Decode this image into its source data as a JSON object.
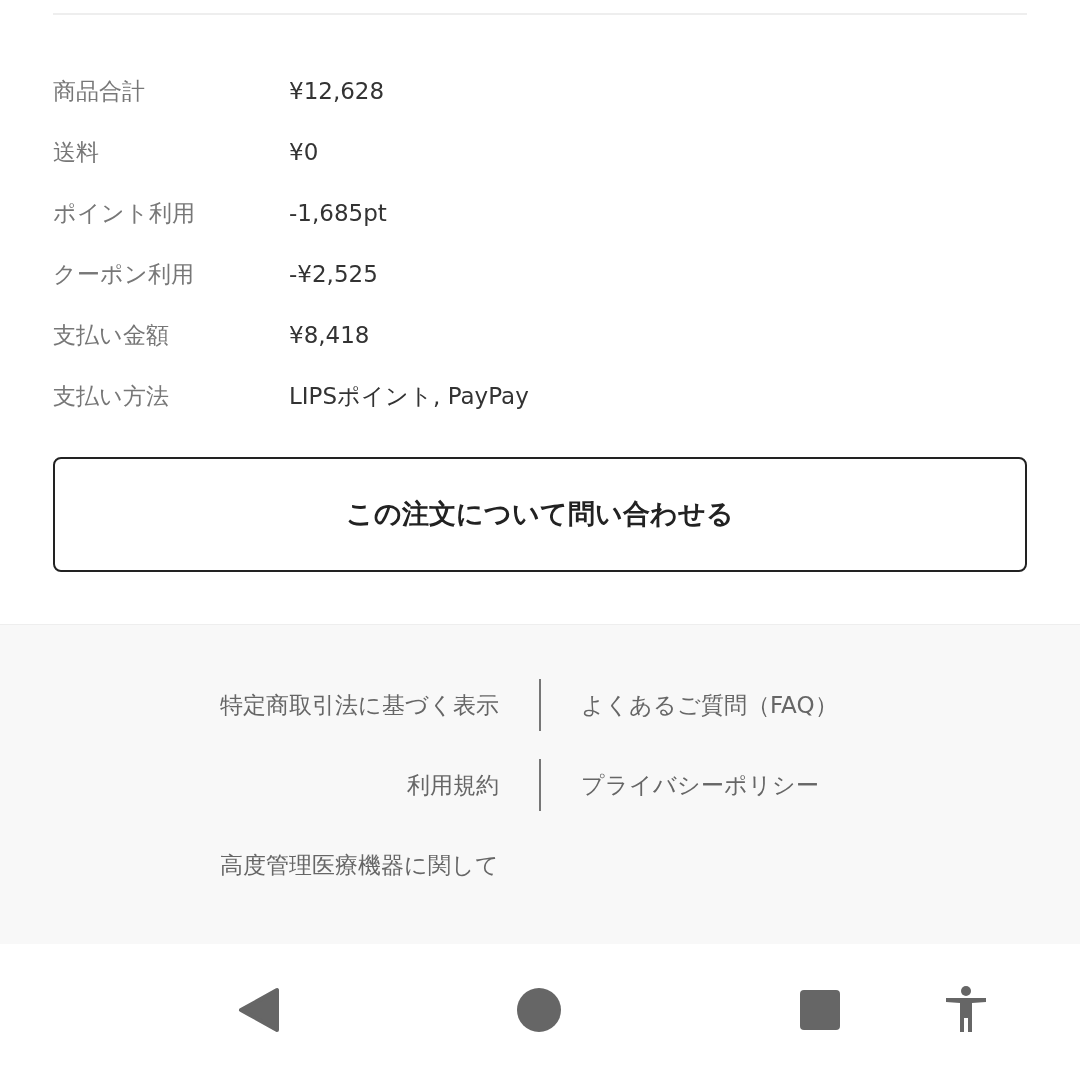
{
  "summary": [
    {
      "label": "商品合計",
      "value": "¥12,628"
    },
    {
      "label": "送料",
      "value": "¥0"
    },
    {
      "label": "ポイント利用",
      "value": "-1,685pt"
    },
    {
      "label": "クーポン利用",
      "value": "-¥2,525"
    },
    {
      "label": "支払い金額",
      "value": "¥8,418"
    },
    {
      "label": "支払い方法",
      "value": "LIPSポイント, PayPay"
    }
  ],
  "contact_button": "この注文について問い合わせる",
  "footer_links": [
    [
      "特定商取引法に基づく表示",
      "よくあるご質問（FAQ）"
    ],
    [
      "利用規約",
      "プライバシーポリシー"
    ],
    [
      "高度管理医療機器に関して"
    ]
  ]
}
